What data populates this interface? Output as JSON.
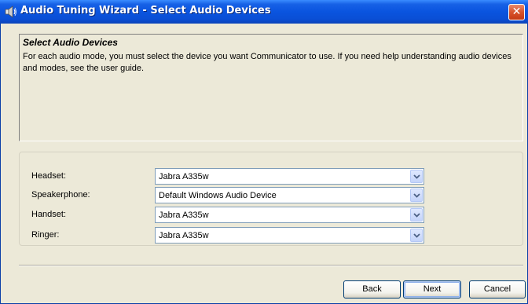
{
  "window": {
    "title": "Audio Tuning Wizard - Select Audio Devices",
    "close_label": "✕"
  },
  "header": {
    "title": "Select Audio Devices",
    "description": "For each audio mode, you must select the device you want Communicator to use. If you need help understanding audio devices and modes, see the user guide."
  },
  "devices": [
    {
      "label": "Headset:",
      "value": "Jabra A335w"
    },
    {
      "label": "Speakerphone:",
      "value": "Default Windows Audio Device"
    },
    {
      "label": "Handset:",
      "value": "Jabra A335w"
    },
    {
      "label": "Ringer:",
      "value": "Jabra A335w"
    }
  ],
  "buttons": {
    "back": "Back",
    "next": "Next",
    "cancel": "Cancel"
  },
  "icons": {
    "title": "audio-speaker-icon",
    "close": "close-icon",
    "dropdown": "chevron-down-icon"
  },
  "colors": {
    "titlebar": "#0a54df",
    "close": "#d8532b",
    "dropdown_border": "#7f9db9",
    "window_bg": "#ece9d8"
  }
}
